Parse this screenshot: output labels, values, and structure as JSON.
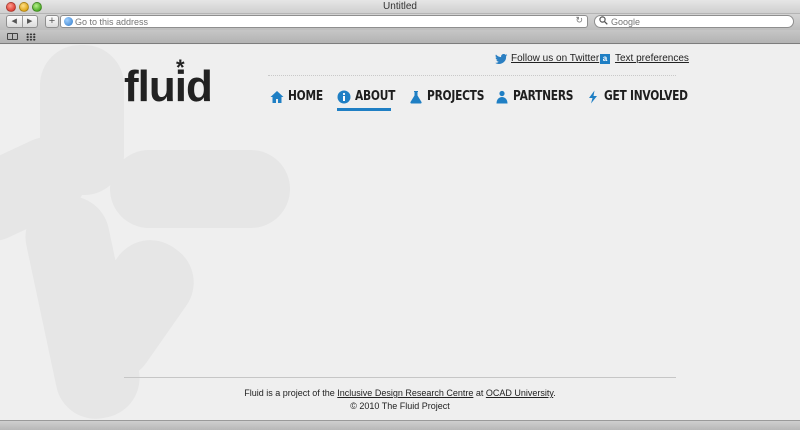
{
  "window": {
    "title": "Untitled"
  },
  "toolbar": {
    "address_placeholder": "Go to this address",
    "search_placeholder": "Google",
    "back": "◀",
    "forward": "▶",
    "add": "+",
    "reload": "↻"
  },
  "site": {
    "logo": "flu",
    "logo_rest": "id",
    "logo_star": "*",
    "utility_links": {
      "twitter": "Follow us on Twitter",
      "text_prefs": "Text preferences",
      "text_prefs_icon_letter": "a"
    },
    "nav": {
      "home": "HOME",
      "about": "ABOUT",
      "projects": "PROJECTS",
      "partners": "PARTNERS",
      "involved": "GET INVOLVED"
    },
    "footer": {
      "prefix": "Fluid is a project of the ",
      "idrc": "Inclusive Design Research Centre",
      "mid": " at ",
      "ocad": "OCAD University",
      "suffix": ".",
      "copyright": "© 2010 The Fluid Project"
    }
  },
  "colors": {
    "accent": "#1f7fc4",
    "text": "#1e1e1e",
    "watermark": "#e6e6e6"
  }
}
